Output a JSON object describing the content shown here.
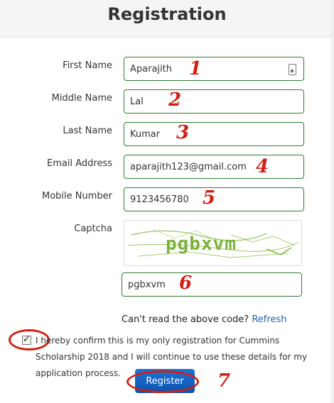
{
  "header": {
    "title": "Registration"
  },
  "form": {
    "fields": [
      {
        "label": "First Name",
        "value": "Aparajith",
        "marker": "1"
      },
      {
        "label": "Middle Name",
        "value": "Lal",
        "marker": "2"
      },
      {
        "label": "Last Name",
        "value": "Kumar",
        "marker": "3"
      },
      {
        "label": "Email Address",
        "value": "aparajith123@gmail.com",
        "marker": "4"
      },
      {
        "label": "Mobile Number",
        "value": "9123456780",
        "marker": "5"
      }
    ],
    "captcha": {
      "label": "Captcha",
      "image_text": "pgbxvm",
      "input_value": "pgbxvm",
      "marker": "6",
      "cant_read_text": "Can't read the above code?",
      "refresh_label": "Refresh"
    },
    "confirm": {
      "checked": true,
      "text": "I hereby confirm this is my only registration for Cummins Scholarship 2018 and I will continue to use these details for my application process."
    },
    "register": {
      "label": "Register",
      "marker": "7"
    }
  },
  "colors": {
    "marker": "#d21f12",
    "field_border": "#2e7d32",
    "button": "#1565c0",
    "link": "#1b5fb5"
  }
}
